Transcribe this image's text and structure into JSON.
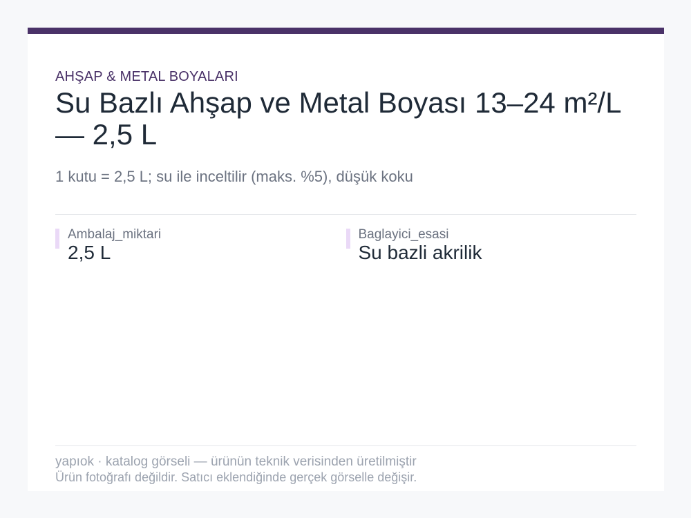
{
  "product": {
    "category": "AHŞAP & METAL BOYALARI",
    "title": "Su Bazlı Ahşap ve Metal Boyası 13–24 m²/L — 2,5 L",
    "subtitle": "1 kutu = 2,5 L; su ile inceltilir (maks. %5), düşük koku"
  },
  "specs": [
    {
      "label": "Ambalaj_miktari",
      "value": "2,5 L"
    },
    {
      "label": "Baglayici_esasi",
      "value": "Su bazli akrilik"
    }
  ],
  "footer": {
    "line1": "yapıok · katalog görseli — ürünün teknik verisinden üretilmiştir",
    "line2": "Ürün fotoğrafı değildir. Satıcı eklendiğinde gerçek görselle değişir."
  },
  "colors": {
    "accent": "#4a3268",
    "marker": "#ead9f7",
    "background": "#f7f8fa"
  }
}
